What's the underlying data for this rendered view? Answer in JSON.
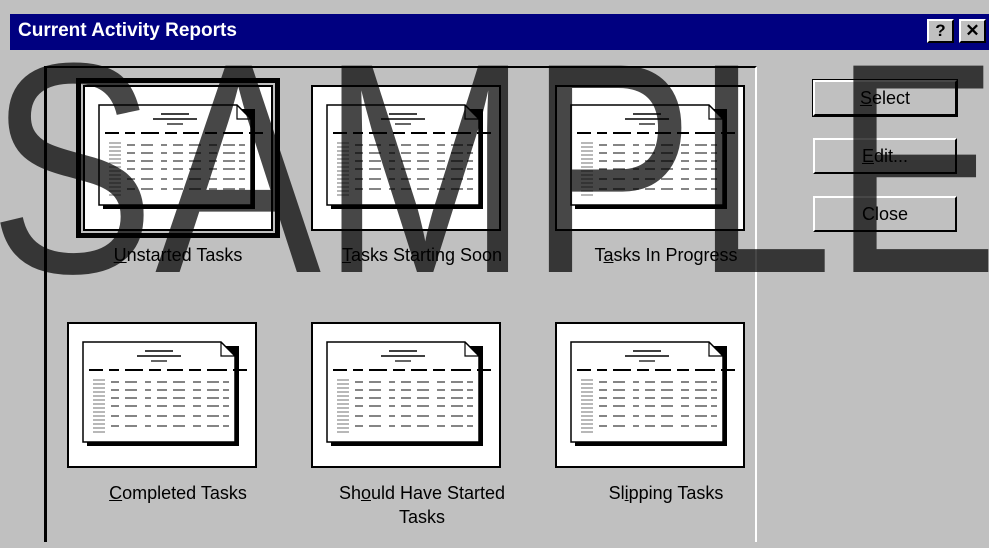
{
  "window": {
    "title": "Current Activity Reports",
    "help_glyph": "?",
    "close_glyph": "✕"
  },
  "reports": [
    {
      "label": "Unstarted Tasks",
      "accel": "U",
      "selected": true
    },
    {
      "label": "Tasks Starting Soon",
      "accel": "T",
      "selected": false
    },
    {
      "label": "Tasks In Progress",
      "accel": "a",
      "selected": false
    },
    {
      "label": "Completed Tasks",
      "accel": "C",
      "selected": false
    },
    {
      "label": "Should Have Started Tasks",
      "accel": "o",
      "selected": false
    },
    {
      "label": "Slipping Tasks",
      "accel": "i",
      "selected": false
    }
  ],
  "buttons": {
    "select": "Select",
    "edit": "Edit...",
    "close": "Close"
  },
  "watermark": "SAMPLE"
}
